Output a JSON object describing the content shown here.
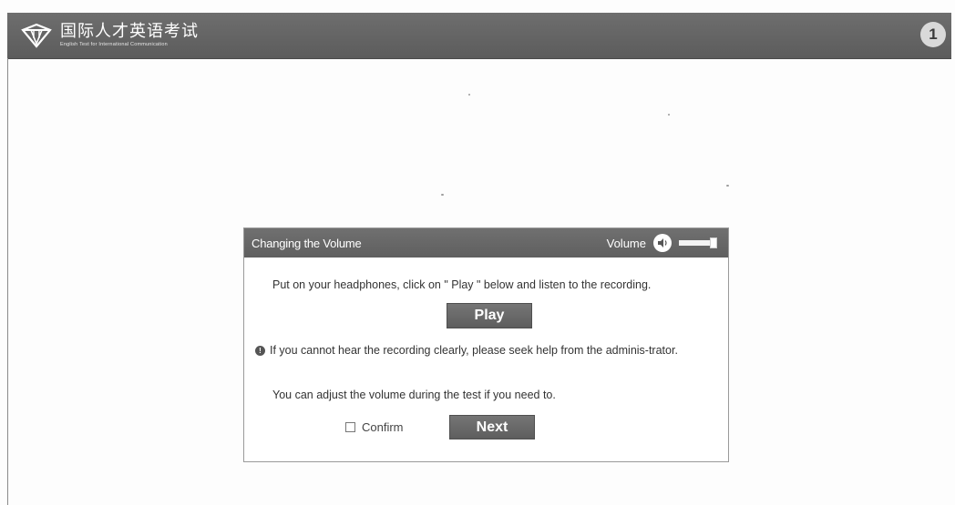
{
  "header": {
    "logo_cn": "国际人才英语考试",
    "logo_en": "English Test for International Communication",
    "page_number": "1"
  },
  "dialog": {
    "title": "Changing the Volume",
    "volume_label": "Volume",
    "volume_level": 1.0,
    "instruction": "Put on your headphones, click on \" Play \" below and listen to the recording.",
    "play_label": "Play",
    "notice": "If you cannot hear the recording clearly, please seek help from the adminis-trator.",
    "adjust_text": "You can adjust the volume during the test if you need to.",
    "confirm_label": "Confirm",
    "next_label": "Next"
  },
  "icons": {
    "logo": "logo-icon",
    "volume": "speaker-icon",
    "info": "info-icon"
  },
  "colors": {
    "bar": "#666666",
    "button": "#6a6a6a",
    "badge": "#d9d9d9"
  }
}
